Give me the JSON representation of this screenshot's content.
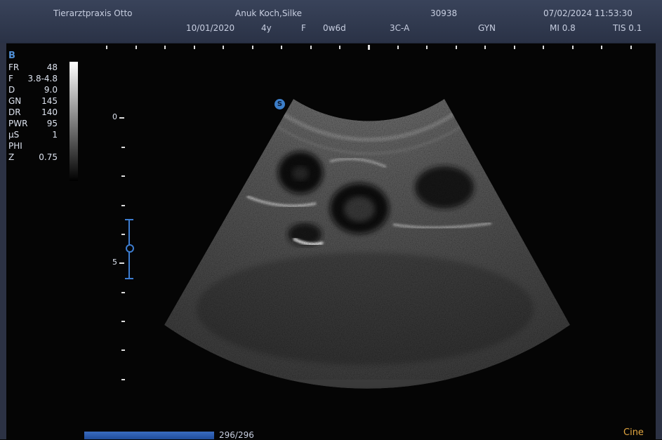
{
  "header": {
    "clinic": "Tierarztpraxis Otto",
    "patient": "Anuk Koch,Silke",
    "patient_id": "30938",
    "datetime": "07/02/2024 11:53:30",
    "birth_date": "10/01/2020",
    "age": "4y",
    "sex": "F",
    "ga": "0w6d",
    "probe": "3C-A",
    "exam": "GYN",
    "mi": "MI 0.8",
    "tis": "TIS 0.1"
  },
  "params": {
    "mode": "B",
    "rows": [
      {
        "k": "FR",
        "v": "48"
      },
      {
        "k": "F",
        "v": "3.8-4.8"
      },
      {
        "k": "D",
        "v": "9.0"
      },
      {
        "k": "GN",
        "v": "145"
      },
      {
        "k": "DR",
        "v": "140"
      },
      {
        "k": "PWR",
        "v": "95"
      },
      {
        "k": "μS",
        "v": "1"
      },
      {
        "k": "PHI",
        "v": ""
      },
      {
        "k": "Z",
        "v": "0.75"
      }
    ]
  },
  "depth_scale": {
    "label_0": "0",
    "label_5": "5"
  },
  "orientation_marker": "S",
  "cine": {
    "count": "296/296",
    "label": "Cine"
  },
  "colors": {
    "accent_blue": "#3d7dd0",
    "cine_orange": "#e2a640"
  }
}
